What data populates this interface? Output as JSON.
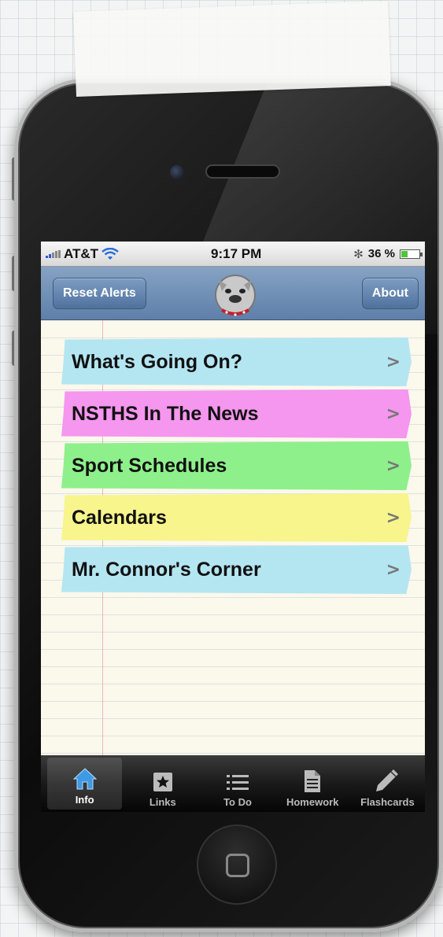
{
  "status": {
    "carrier": "AT&T",
    "time": "9:17 PM",
    "battery_pct": "36 %",
    "battery_level": 0.36
  },
  "nav": {
    "left_button": "Reset Alerts",
    "right_button": "About",
    "logo_icon": "bulldog-logo-icon"
  },
  "menu": {
    "items": [
      {
        "label": "What's Going On?",
        "color": "#b4e6f2"
      },
      {
        "label": "NSTHS In The News",
        "color": "#f596ef"
      },
      {
        "label": "Sport Schedules",
        "color": "#8ef08a"
      },
      {
        "label": "Calendars",
        "color": "#f7f58c"
      },
      {
        "label": "Mr. Connor's Corner",
        "color": "#b4e6f2"
      }
    ]
  },
  "tabs": [
    {
      "label": "Info",
      "icon": "home-icon",
      "active": true
    },
    {
      "label": "Links",
      "icon": "star-icon",
      "active": false
    },
    {
      "label": "To Do",
      "icon": "list-icon",
      "active": false
    },
    {
      "label": "Homework",
      "icon": "document-icon",
      "active": false
    },
    {
      "label": "Flashcards",
      "icon": "pencil-icon",
      "active": false
    }
  ]
}
